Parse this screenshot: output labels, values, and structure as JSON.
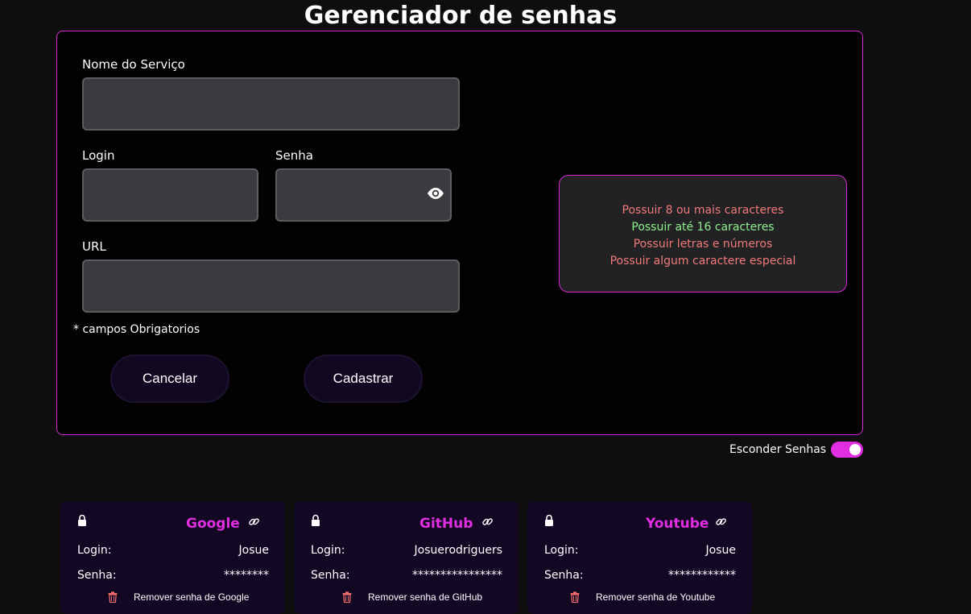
{
  "page": {
    "title": "Gerenciador de senhas"
  },
  "form": {
    "service_label": "Nome do Serviço",
    "service_value": "",
    "login_label": "Login",
    "login_value": "",
    "password_label": "Senha",
    "password_value": "",
    "url_label": "URL",
    "url_value": "",
    "required_note": "* campos Obrigatorios",
    "cancel_label": "Cancelar",
    "submit_label": "Cadastrar"
  },
  "rules": [
    {
      "text": "Possuir 8 ou mais caracteres",
      "valid": false
    },
    {
      "text": "Possuir até 16 caracteres",
      "valid": true
    },
    {
      "text": "Possuir letras e números",
      "valid": false
    },
    {
      "text": "Possuir algum caractere especial",
      "valid": false
    }
  ],
  "colors": {
    "accent": "#e22ee2",
    "valid": "#8ef08e",
    "invalid": "#f07a7a",
    "trash": "#f06a6a"
  },
  "toggle": {
    "label": "Esconder Senhas",
    "checked": true
  },
  "cards": [
    {
      "service": "Google",
      "login_label": "Login:",
      "login": "Josue",
      "password_label": "Senha:",
      "password": "********",
      "remove_label": "Remover senha de Google"
    },
    {
      "service": "GitHub",
      "login_label": "Login:",
      "login": "Josuerodriguers",
      "password_label": "Senha:",
      "password": "****************",
      "remove_label": "Remover senha de GitHub"
    },
    {
      "service": "Youtube",
      "login_label": "Login:",
      "login": "Josue",
      "password_label": "Senha:",
      "password": "************",
      "remove_label": "Remover senha de Youtube"
    }
  ],
  "icons": {
    "eye": "eye-icon",
    "lock": "lock-icon",
    "link": "link-icon",
    "trash": "trash-icon"
  }
}
